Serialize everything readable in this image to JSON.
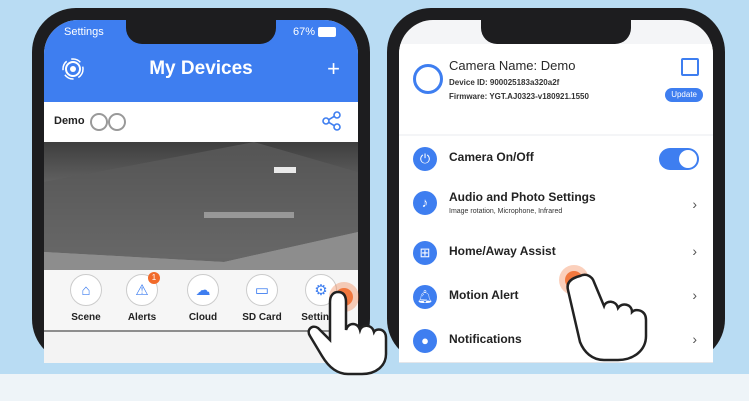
{
  "left_phone": {
    "status": {
      "carrier": "Settings",
      "battery": "67%"
    },
    "header": {
      "title": "My Devices",
      "add_label": "+"
    },
    "device_bar": {
      "name": "Demo"
    },
    "toolbar": [
      {
        "label": "Scene",
        "icon": "home-icon"
      },
      {
        "label": "Alerts",
        "icon": "alarm-icon",
        "badge": "1"
      },
      {
        "label": "Cloud",
        "icon": "cloud-icon"
      },
      {
        "label": "SD Card",
        "icon": "sd-card-icon"
      },
      {
        "label": "Settings",
        "icon": "gear-icon"
      }
    ]
  },
  "right_phone": {
    "camera": {
      "name_label": "Camera Name:",
      "name": "Demo",
      "device_id": "Device ID: 900025183a320a2f",
      "firmware": "Firmware: YGT.AJ0323-v180921.1550",
      "update_label": "Update"
    },
    "settings": [
      {
        "label": "Camera On/Off",
        "sub": "",
        "control": "toggle",
        "on": true
      },
      {
        "label": "Audio and Photo Settings",
        "sub": "Image rotation, Microphone, Infrared",
        "control": "chevron"
      },
      {
        "label": "Home/Away Assist",
        "sub": "",
        "control": "chevron"
      },
      {
        "label": "Motion Alert",
        "sub": "",
        "control": "chevron"
      },
      {
        "label": "Notifications",
        "sub": "",
        "control": "chevron"
      }
    ],
    "chevron": "›"
  },
  "colors": {
    "accent": "#3e7ef0",
    "tap": "#f16a2a",
    "background": "#b9dcf3"
  }
}
